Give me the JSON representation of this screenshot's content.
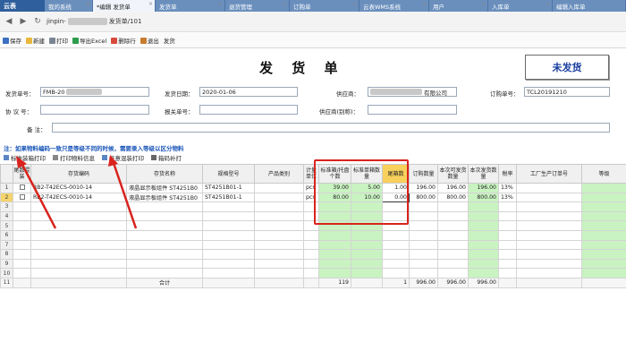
{
  "tabs": {
    "logo": "云表",
    "items": [
      "我的系统",
      "*编辑 发货单",
      "发货单",
      "退货管理",
      "订购单",
      "云表WMS系统",
      "用户",
      "入库单",
      "编辑入库单"
    ]
  },
  "address": {
    "prefix": "jinpin-",
    "suffix": "发货单/101"
  },
  "toolbar": {
    "save": "保存",
    "new": "新建",
    "print": "打印",
    "export": "导出Excel",
    "delete_row": "删除行",
    "exit": "退出",
    "ship": "发货"
  },
  "form": {
    "title": "发 货 单",
    "status": "未发货",
    "labels": {
      "doc_no": "发货单号：",
      "ship_date": "发货日期：",
      "supplier": "供应商：",
      "order_no": "订购单号：",
      "agreement_no": "协 议 号：",
      "customs_no": "报关单号：",
      "supplier_alias": "供应商(别称)：",
      "remark": "备 注："
    },
    "values": {
      "doc_no_prefix": "FMB-20",
      "ship_date": "2020-01-06",
      "supplier_suffix": "有限公司",
      "order_no": "TCL20191210"
    }
  },
  "note": "注：如果物料编码一致只是等级不同的时候，需要录入等级以区分物料",
  "grid_toolbar": {
    "label_print": "标准装箱打印",
    "material_print": "打印物料信息",
    "mixed_print": "任意混装打印",
    "tail_print": "箱码补打"
  },
  "grid": {
    "headers": [
      "尾数混装",
      "存货编码",
      "存货名称",
      "规格型号",
      "产品类别",
      "计量单位",
      "标准箱/托盘个数",
      "标准单箱数量",
      "尾箱数",
      "订购数量",
      "本次可发货数量",
      "本次发货数量",
      "税率",
      "工厂生产订单号",
      "等级"
    ],
    "rows": [
      {
        "row": "1",
        "code": "RB2-T42ECS-0010-14",
        "name": "液晶显示板组件 ST4251B0",
        "spec": "ST4251B01-1",
        "unit": "pcs",
        "per_pallet": "39.00",
        "per_box": "5.00",
        "tail": "1.00",
        "order_qty": "196.00",
        "can_ship": "196.00",
        "ship_qty": "196.00",
        "tax": "13%"
      },
      {
        "row": "2",
        "code": "RB2-T42ECS-0010-14",
        "name": "液晶显示板组件 ST4251B0",
        "spec": "ST4251B01-1",
        "unit": "pcs",
        "per_pallet": "80.00",
        "per_box": "10.00",
        "tail": "0.00",
        "order_qty": "800.00",
        "can_ship": "800.00",
        "ship_qty": "800.00",
        "tax": "13%"
      }
    ],
    "empty_row_numbers": [
      "3",
      "4",
      "5",
      "6",
      "7",
      "8",
      "9",
      "10"
    ],
    "total": {
      "row": "11",
      "label": "合计",
      "per_pallet": "119",
      "tail": "1",
      "order_qty": "996.00",
      "can_ship": "996.00",
      "ship_qty": "996.00"
    }
  }
}
